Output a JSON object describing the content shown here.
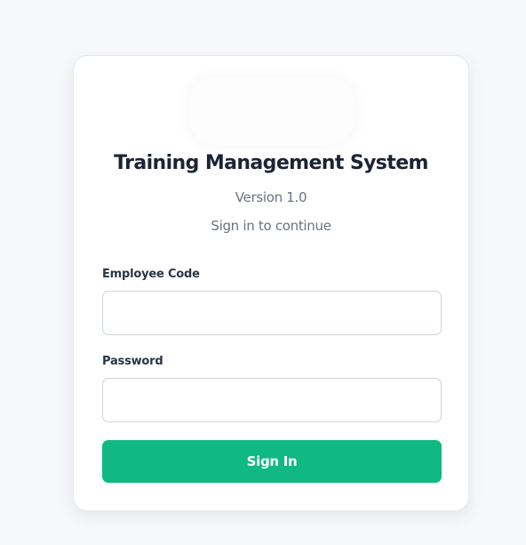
{
  "app": {
    "title": "Training Management System",
    "version": "Version 1.0",
    "subtitle": "Sign in to continue"
  },
  "form": {
    "employee_code_label": "Employee Code",
    "employee_code_value": "",
    "password_label": "Password",
    "password_value": "",
    "submit_label": "Sign In"
  },
  "colors": {
    "accent": "#10b981",
    "title": "#1c2434",
    "muted": "#6b7280",
    "background": "#f7f8fa"
  }
}
